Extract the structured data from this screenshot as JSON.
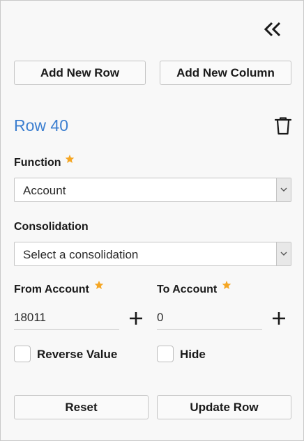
{
  "header": {
    "collapse_icon": "double-chevron-left-icon"
  },
  "toolbar": {
    "add_row_label": "Add New Row",
    "add_column_label": "Add New Column"
  },
  "row": {
    "title": "Row 40",
    "delete_icon": "trash-icon"
  },
  "function": {
    "label": "Function",
    "required": true,
    "value": "Account"
  },
  "consolidation": {
    "label": "Consolidation",
    "placeholder": "Select a consolidation"
  },
  "from_account": {
    "label": "From Account",
    "required": true,
    "value": "18011"
  },
  "to_account": {
    "label": "To Account",
    "required": true,
    "value": "0"
  },
  "options": {
    "reverse_value_label": "Reverse Value",
    "reverse_value_checked": false,
    "hide_label": "Hide",
    "hide_checked": false
  },
  "footer": {
    "reset_label": "Reset",
    "update_label": "Update Row"
  },
  "colors": {
    "accent_blue": "#3c7fd0",
    "required_star": "#f5a623"
  }
}
